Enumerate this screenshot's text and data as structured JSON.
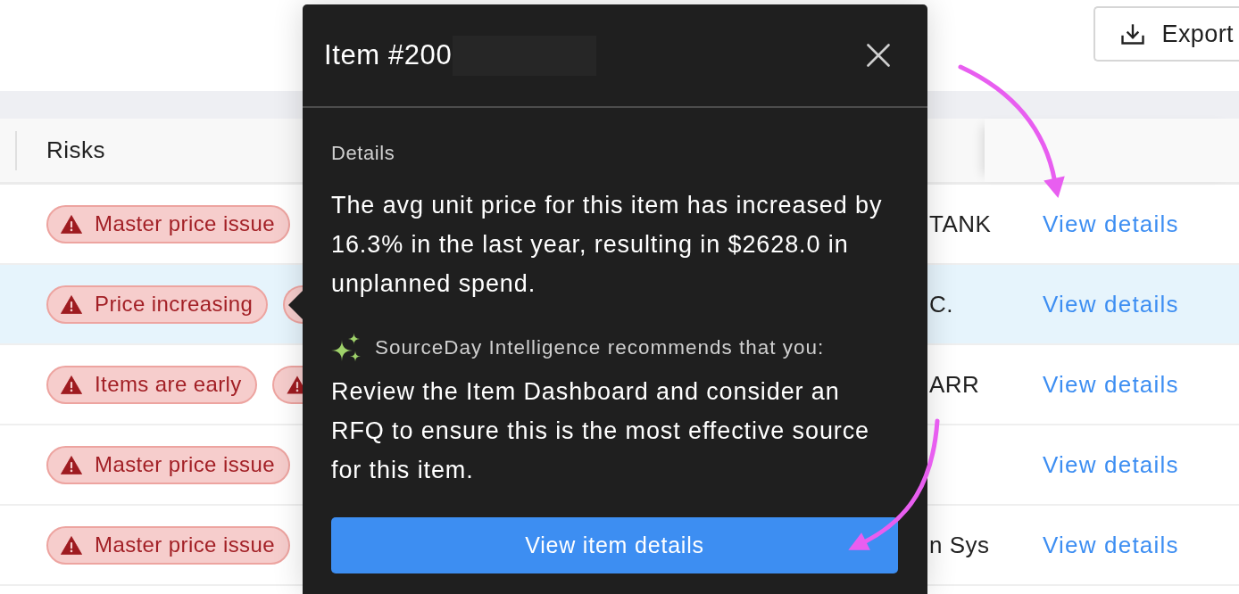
{
  "toolbar": {
    "export_button": "Export"
  },
  "table": {
    "columns": [
      {
        "label": "Risks"
      }
    ],
    "rows": [
      {
        "selected": false,
        "risks": [
          {
            "kind": "badge",
            "label": "Master price issue"
          }
        ],
        "column_2": "TANK",
        "link": "View details"
      },
      {
        "selected": true,
        "risks": [
          {
            "kind": "badge",
            "label": "Price increasing"
          },
          {
            "kind": "edge"
          }
        ],
        "column_2": "C.",
        "link": "View details"
      },
      {
        "selected": false,
        "risks": [
          {
            "kind": "badge",
            "label": "Items are early"
          },
          {
            "kind": "stub"
          }
        ],
        "column_2": "ARR",
        "link": "View details"
      },
      {
        "selected": false,
        "risks": [
          {
            "kind": "badge",
            "label": "Master price issue"
          }
        ],
        "link": "View details"
      },
      {
        "selected": false,
        "risks": [
          {
            "kind": "badge",
            "label": "Master price issue"
          }
        ],
        "column_2": "n Sys",
        "link": "View details"
      }
    ]
  },
  "popover": {
    "title": "Item #200",
    "section_label": "Details",
    "description": "The avg unit price for this item has increased by 16.3% in the last year, resulting in $2628.0 in unplanned spend.",
    "intro": "SourceDay Intelligence recommends that you:",
    "recommendation": "Review the Item Dashboard and consider an RFQ to ensure this is the most effective source for this item.",
    "button": "View item details"
  }
}
